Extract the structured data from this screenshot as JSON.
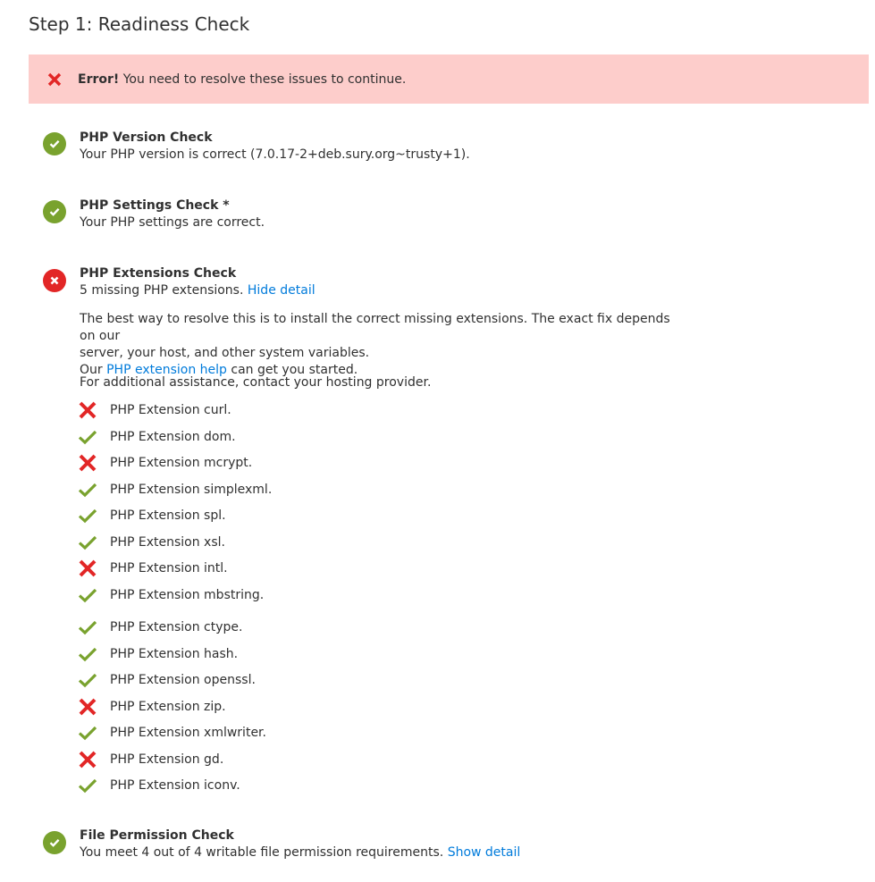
{
  "page_title": "Step 1: Readiness Check",
  "error_banner": {
    "strong": "Error!",
    "text": "You need to resolve these issues to continue."
  },
  "checks": {
    "php_version": {
      "title": "PHP Version Check",
      "desc": "Your PHP version is correct (7.0.17-2+deb.sury.org~trusty+1).",
      "status": "ok"
    },
    "php_settings": {
      "title": "PHP Settings Check *",
      "desc": "Your PHP settings are correct.",
      "status": "ok"
    },
    "php_extensions": {
      "title": "PHP Extensions Check",
      "desc": "5 missing PHP extensions.",
      "toggle_link": "Hide detail",
      "status": "error",
      "help_line1": "The best way to resolve this is to install the correct missing extensions. The exact fix depends on our",
      "help_line2": "server, your host, and other system variables.",
      "help_line3_prefix": "Our",
      "help_link": "PHP extension help",
      "help_line3_suffix": "can get you started.",
      "assistance": "For additional assistance, contact your hosting provider.",
      "extensions": [
        {
          "label": "PHP Extension curl.",
          "status": "error"
        },
        {
          "label": "PHP Extension dom.",
          "status": "ok"
        },
        {
          "label": "PHP Extension mcrypt.",
          "status": "error"
        },
        {
          "label": "PHP Extension simplexml.",
          "status": "ok"
        },
        {
          "label": "PHP Extension spl.",
          "status": "ok"
        },
        {
          "label": "PHP Extension xsl.",
          "status": "ok"
        },
        {
          "label": "PHP Extension intl.",
          "status": "error"
        },
        {
          "label": "PHP Extension mbstring.",
          "status": "ok"
        },
        {
          "label": "PHP Extension ctype.",
          "status": "ok"
        },
        {
          "label": "PHP Extension hash.",
          "status": "ok"
        },
        {
          "label": "PHP Extension openssl.",
          "status": "ok"
        },
        {
          "label": "PHP Extension zip.",
          "status": "error"
        },
        {
          "label": "PHP Extension xmlwriter.",
          "status": "ok"
        },
        {
          "label": "PHP Extension gd.",
          "status": "error"
        },
        {
          "label": "PHP Extension iconv.",
          "status": "ok"
        }
      ]
    },
    "file_permission": {
      "title": "File Permission Check",
      "desc": "You meet 4 out of 4 writable file permission requirements.",
      "toggle_link": "Show detail",
      "status": "ok"
    }
  },
  "colors": {
    "ok": "#79a22e",
    "error": "#e22626",
    "banner_bg": "#fdcdcb",
    "link": "#007bdb"
  }
}
